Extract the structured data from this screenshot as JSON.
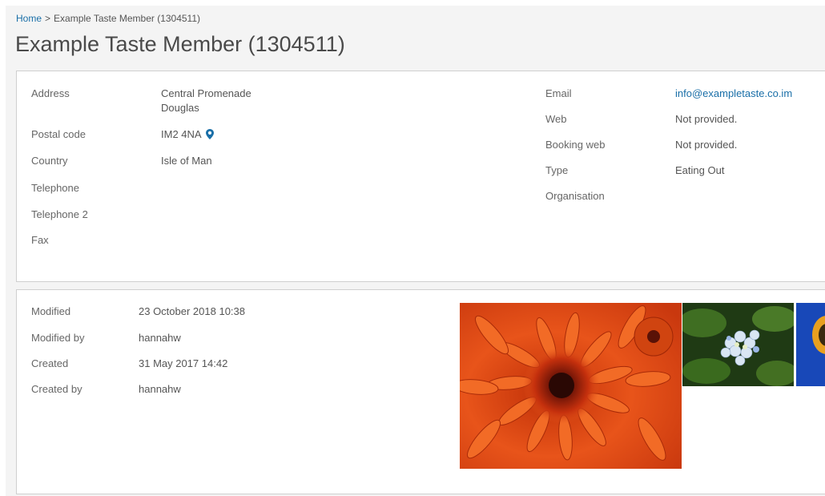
{
  "breadcrumb": {
    "home": "Home",
    "separator": ">",
    "current": "Example Taste Member (1304511)"
  },
  "page_title": "Example Taste Member (1304511)",
  "contact": {
    "address_label": "Address",
    "address_line1": "Central Promenade",
    "address_line2": "Douglas",
    "postal_label": "Postal code",
    "postal_value": "IM2 4NA",
    "country_label": "Country",
    "country_value": "Isle of Man",
    "telephone_label": "Telephone",
    "telephone2_label": "Telephone 2",
    "fax_label": "Fax",
    "email_label": "Email",
    "email_value": "info@exampletaste.co.im",
    "web_label": "Web",
    "web_value": "Not provided.",
    "booking_label": "Booking web",
    "booking_value": "Not provided.",
    "type_label": "Type",
    "type_value": "Eating Out",
    "organisation_label": "Organisation"
  },
  "audit": {
    "modified_label": "Modified",
    "modified_value": "23 October 2018 10:38",
    "modified_by_label": "Modified by",
    "modified_by_value": "hannahw",
    "created_label": "Created",
    "created_value": "31 May 2017 14:42",
    "created_by_label": "Created by",
    "created_by_value": "hannahw"
  },
  "icons": {
    "map_pin": "map-pin-icon"
  },
  "colors": {
    "link": "#1a6fa8",
    "page_bg": "#f4f4f4",
    "panel_border": "#cfcfcf"
  }
}
